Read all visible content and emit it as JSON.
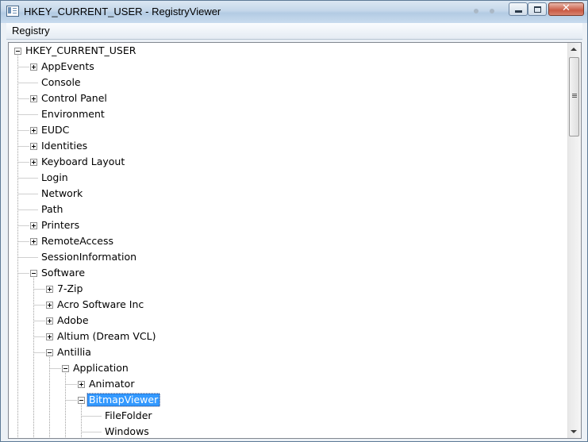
{
  "window": {
    "title": "HKEY_CURRENT_USER - RegistryViewer",
    "minimize_icon": "minimize-icon",
    "maximize_icon": "maximize-icon",
    "close_icon": "close-icon",
    "close_glyph": "✕"
  },
  "menubar": {
    "items": [
      {
        "label": "Registry"
      }
    ]
  },
  "colors": {
    "selection": "#3399ff",
    "selection_text": "#ffffff",
    "tree_lines": "#a0a0a0",
    "expander_border": "#919191"
  },
  "tree": {
    "nodes": [
      {
        "label": "HKEY_CURRENT_USER",
        "depth": 0,
        "expander": "minus"
      },
      {
        "label": "AppEvents",
        "depth": 1,
        "expander": "plus"
      },
      {
        "label": "Console",
        "depth": 1,
        "expander": "none"
      },
      {
        "label": "Control Panel",
        "depth": 1,
        "expander": "plus"
      },
      {
        "label": "Environment",
        "depth": 1,
        "expander": "none"
      },
      {
        "label": "EUDC",
        "depth": 1,
        "expander": "plus"
      },
      {
        "label": "Identities",
        "depth": 1,
        "expander": "plus"
      },
      {
        "label": "Keyboard Layout",
        "depth": 1,
        "expander": "plus"
      },
      {
        "label": "Login",
        "depth": 1,
        "expander": "none"
      },
      {
        "label": "Network",
        "depth": 1,
        "expander": "none"
      },
      {
        "label": "Path",
        "depth": 1,
        "expander": "none"
      },
      {
        "label": "Printers",
        "depth": 1,
        "expander": "plus"
      },
      {
        "label": "RemoteAccess",
        "depth": 1,
        "expander": "plus"
      },
      {
        "label": "SessionInformation",
        "depth": 1,
        "expander": "none"
      },
      {
        "label": "Software",
        "depth": 1,
        "expander": "minus"
      },
      {
        "label": "7-Zip",
        "depth": 2,
        "expander": "plus"
      },
      {
        "label": "Acro Software Inc",
        "depth": 2,
        "expander": "plus"
      },
      {
        "label": "Adobe",
        "depth": 2,
        "expander": "plus"
      },
      {
        "label": "Altium (Dream VCL)",
        "depth": 2,
        "expander": "plus"
      },
      {
        "label": "Antillia",
        "depth": 2,
        "expander": "minus"
      },
      {
        "label": "Application",
        "depth": 3,
        "expander": "minus"
      },
      {
        "label": "Animator",
        "depth": 4,
        "expander": "plus"
      },
      {
        "label": "BitmapViewer",
        "depth": 4,
        "expander": "minus",
        "selected": true
      },
      {
        "label": "FileFolder",
        "depth": 5,
        "expander": "none"
      },
      {
        "label": "Windows",
        "depth": 5,
        "expander": "none"
      }
    ]
  },
  "scrollbar": {
    "up_icon": "scroll-up-arrow-icon",
    "down_icon": "scroll-down-arrow-icon",
    "position": 0.0,
    "visible_fraction": 0.2
  }
}
